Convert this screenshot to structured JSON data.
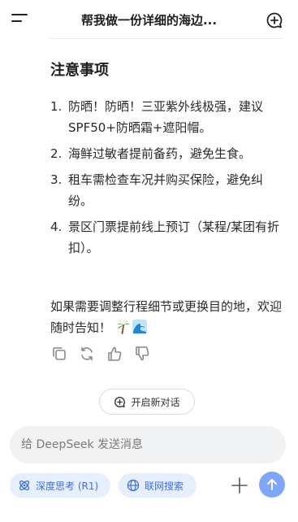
{
  "header": {
    "title": "帮我做一份详细的海边..."
  },
  "section_title": "注意事项",
  "notes": [
    {
      "num": "1.",
      "text": "防晒！防晒！三亚紫外线极强，建议SPF50+防晒霜+遮阳帽。"
    },
    {
      "num": "2.",
      "text": "海鲜过敏者提前备药，避免生食。"
    },
    {
      "num": "3.",
      "text": "租车需检查车况并购买保险，避免纠纷。"
    },
    {
      "num": "4.",
      "text": "景区门票提前线上预订（某程/某团有折扣）。"
    }
  ],
  "closing": "如果需要调整行程细节或更换目的地，欢迎随时告知！",
  "icons": {
    "palm": "palm-tree-emoji",
    "wave": "wave-emoji",
    "copy": "copy-icon",
    "regenerate": "regenerate-icon",
    "like": "thumbs-up-icon",
    "dislike": "thumbs-down-icon"
  },
  "new_chat_label": "开启新对话",
  "composer": {
    "placeholder": "给 DeepSeek 发送消息"
  },
  "chips": {
    "deep_think": "深度思考 (R1)",
    "web_search": "联网搜索"
  },
  "colors": {
    "accent": "#3b6fe0",
    "chip_bg": "#e7efff",
    "send_bg": "#7fa7f5"
  }
}
